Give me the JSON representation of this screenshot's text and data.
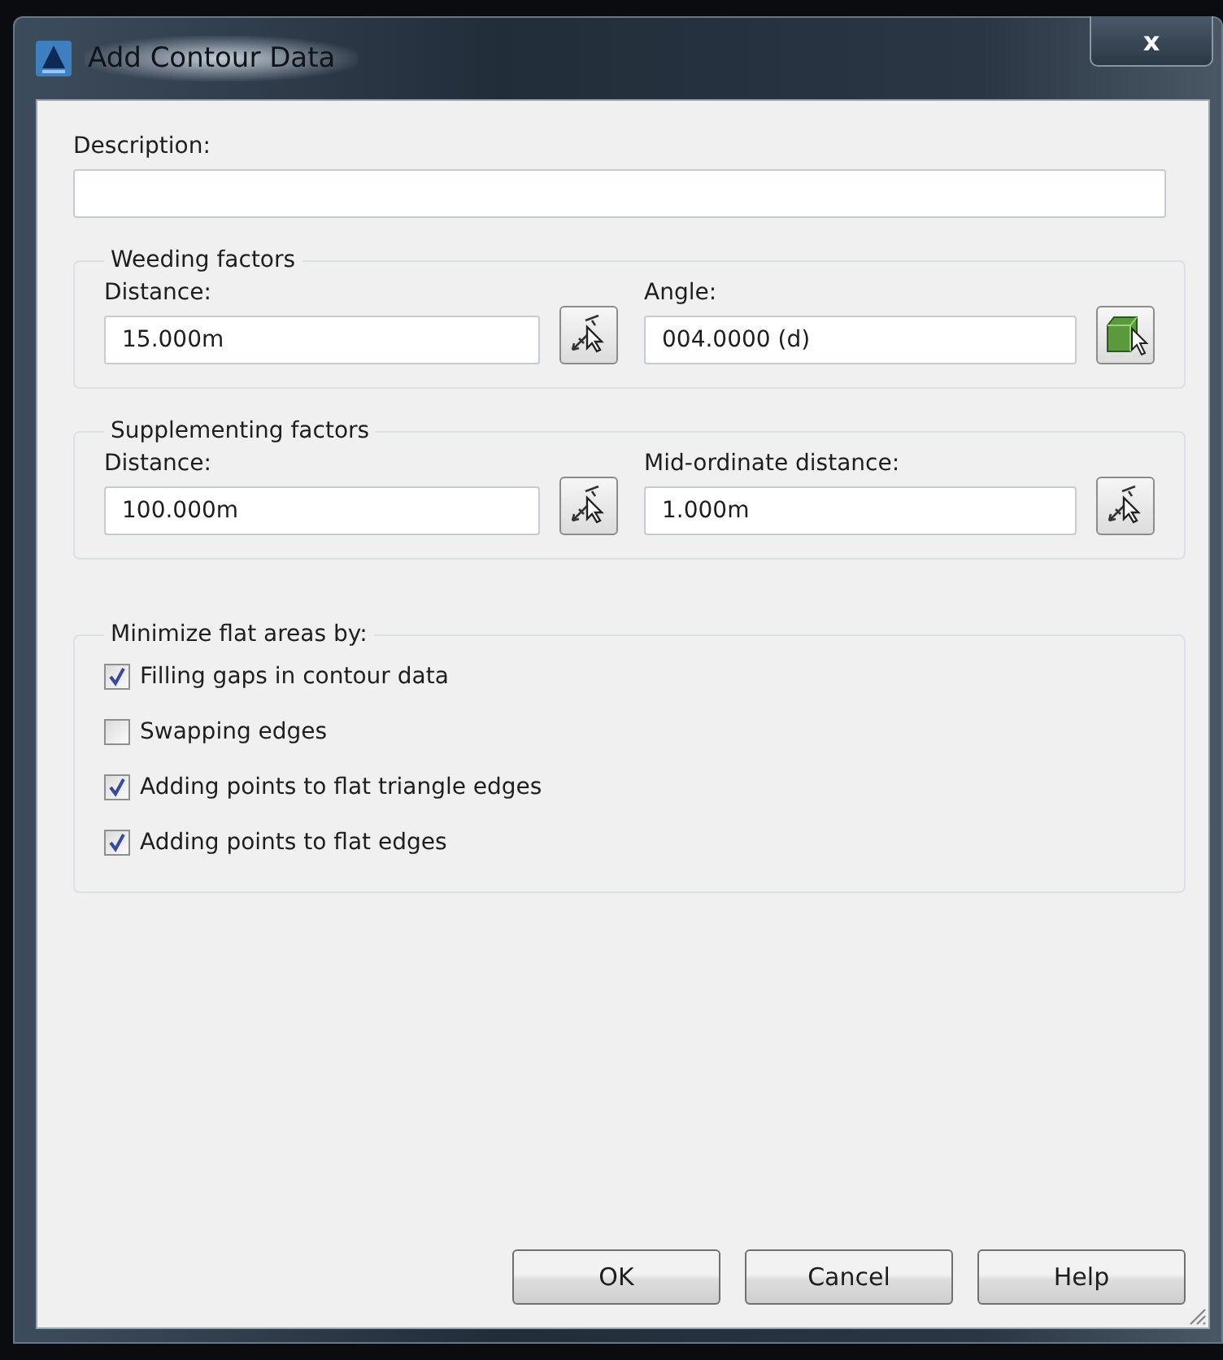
{
  "window": {
    "title": "Add Contour Data",
    "close": "x"
  },
  "description": {
    "label": "Description:"
  },
  "groups": [
    {
      "title": "Weeding factors",
      "fields": [
        {
          "label": "Distance:",
          "value": "15.000m",
          "kind": "pick"
        },
        {
          "label": "Angle:",
          "value": "004.0000 (d)",
          "kind": "cube"
        }
      ]
    },
    {
      "title": "Supplementing factors",
      "fields": [
        {
          "label": "Distance:",
          "value": "100.000m",
          "kind": "pick"
        },
        {
          "label": "Mid-ordinate distance:",
          "value": "1.000m",
          "kind": "pick"
        }
      ]
    }
  ],
  "minimize": {
    "title": "Minimize flat areas by:",
    "options": [
      {
        "label": "Filling gaps in contour data",
        "checked": true
      },
      {
        "label": "Swapping edges",
        "checked": false
      },
      {
        "label": "Adding points to flat triangle edges",
        "checked": true
      },
      {
        "label": "Adding points to flat edges",
        "checked": true
      }
    ]
  },
  "buttons": [
    "OK",
    "Cancel",
    "Help"
  ]
}
